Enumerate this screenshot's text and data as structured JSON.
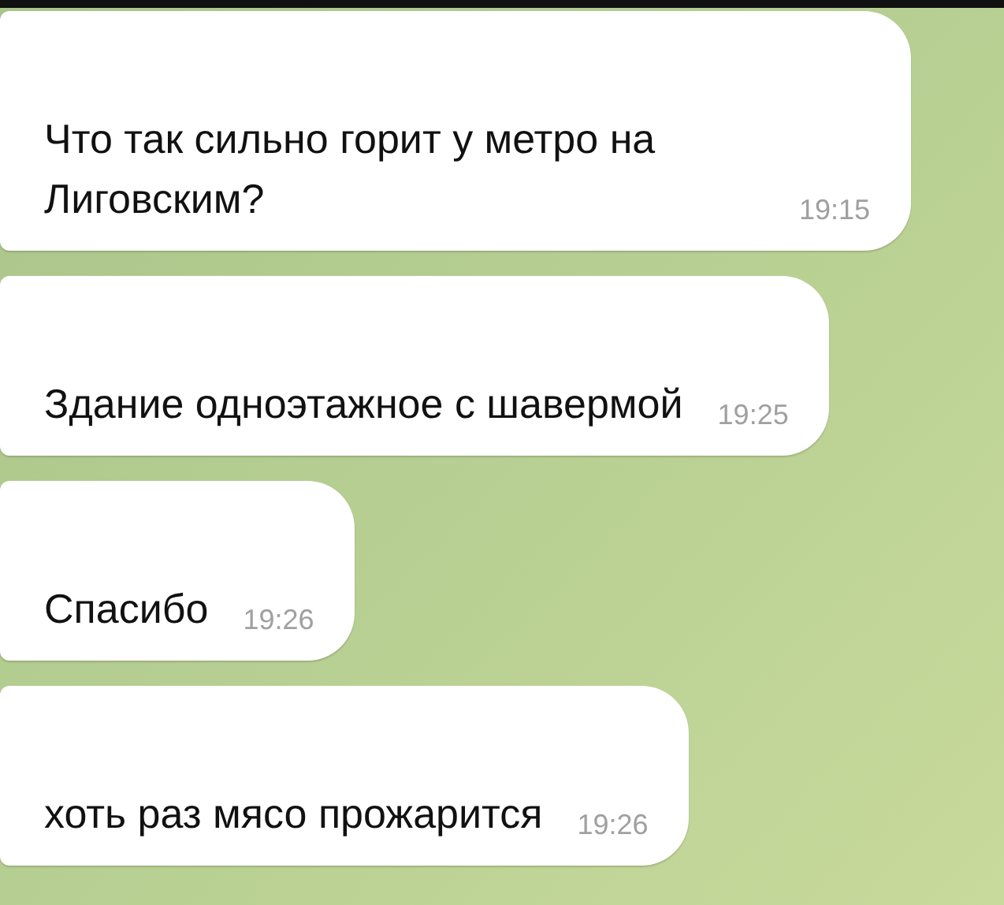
{
  "messages": [
    {
      "text": "Что так сильно горит у метро на Лиговским?",
      "time": "19:15"
    },
    {
      "text": "Здание одноэтажное с шавермой",
      "time": "19:25"
    },
    {
      "text": "Спасибо",
      "time": "19:26"
    },
    {
      "text": "хоть раз мясо прожарится",
      "time": "19:26"
    }
  ]
}
